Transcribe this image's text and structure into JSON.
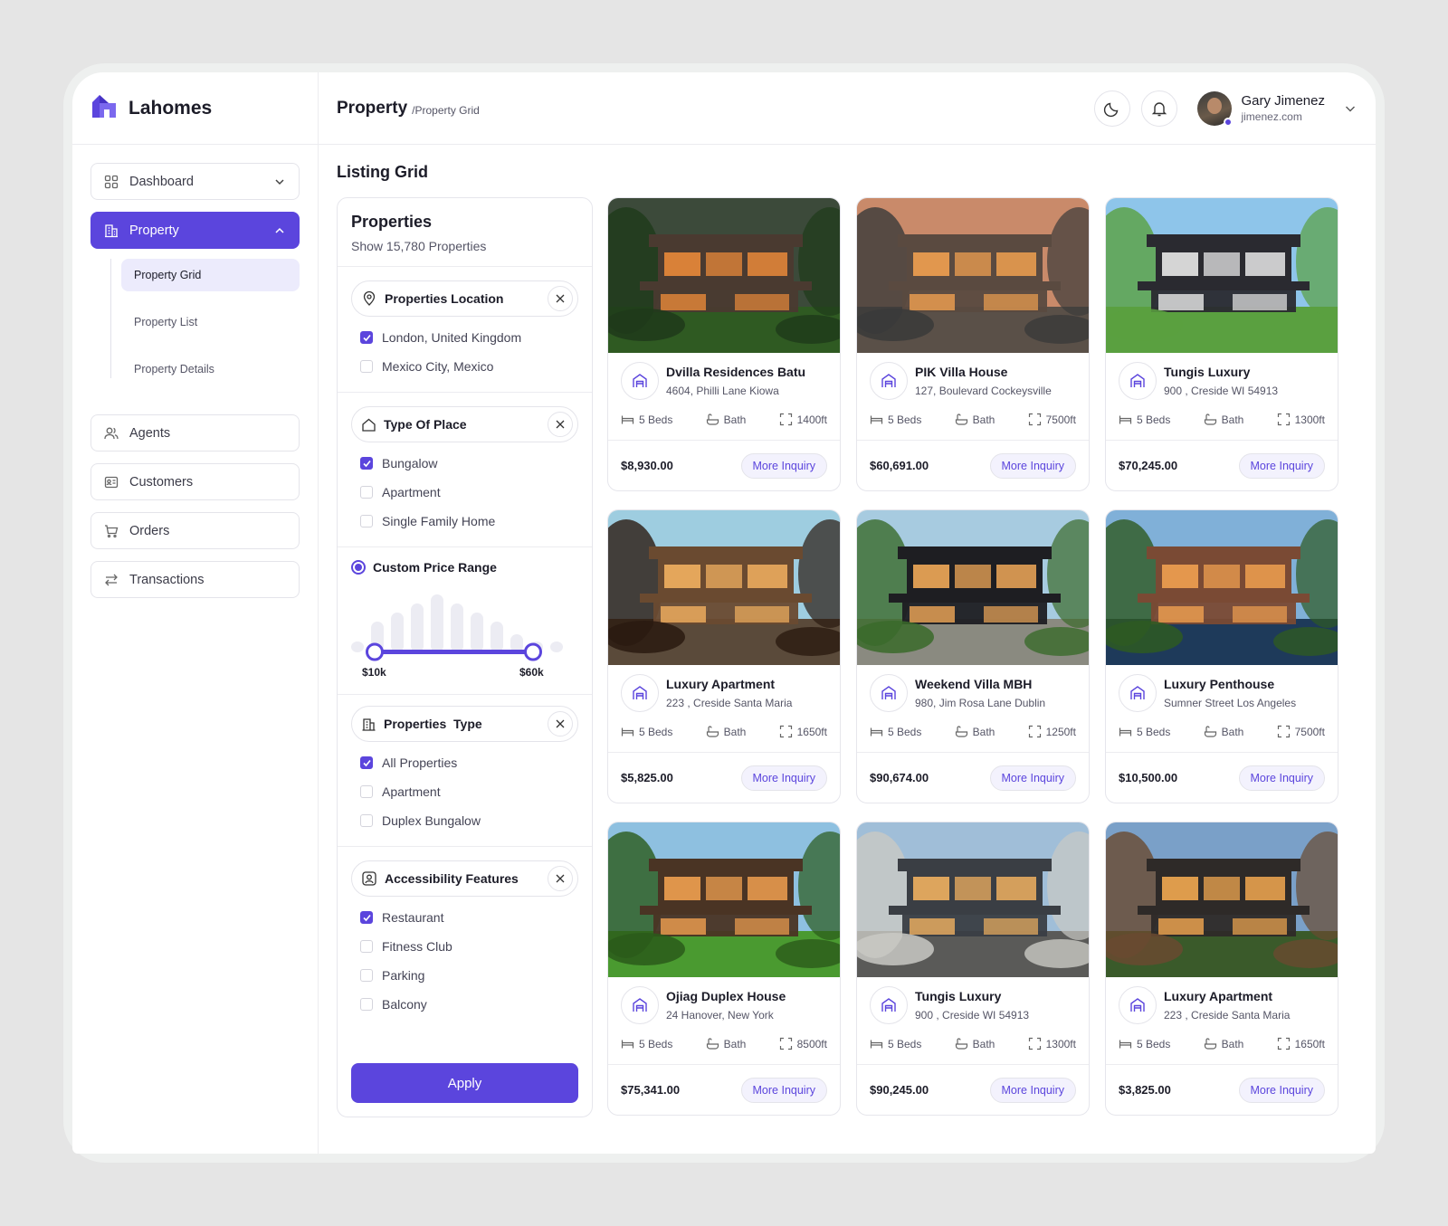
{
  "brand": {
    "name": "Lahomes"
  },
  "header": {
    "title": "Property",
    "breadcrumb": "/Property Grid"
  },
  "user": {
    "name": "Gary Jimenez",
    "email": "jimenez.com"
  },
  "sidebar": {
    "items": [
      {
        "label": "Dashboard"
      },
      {
        "label": "Property"
      },
      {
        "label": "Agents"
      },
      {
        "label": "Customers"
      },
      {
        "label": "Orders"
      },
      {
        "label": "Transactions"
      }
    ],
    "subitems": [
      {
        "label": "Property Grid"
      },
      {
        "label": "Property List"
      },
      {
        "label": "Property Details"
      }
    ]
  },
  "page": {
    "title": "Listing Grid"
  },
  "filter": {
    "title": "Properties",
    "count": "Show 15,780 Properties",
    "location": {
      "label": "Properties Location",
      "options": [
        {
          "label": "London, United Kingdom",
          "checked": true
        },
        {
          "label": "Mexico City, Mexico",
          "checked": false
        }
      ]
    },
    "place": {
      "label": "Type Of Place",
      "options": [
        {
          "label": "Bungalow",
          "checked": true
        },
        {
          "label": "Apartment",
          "checked": false
        },
        {
          "label": "Single Family Home",
          "checked": false
        }
      ]
    },
    "price": {
      "label": "Custom Price Range",
      "min_label": "$10k",
      "max_label": "$60k"
    },
    "ptype": {
      "label": "Properties  Type",
      "options": [
        {
          "label": "All Properties",
          "checked": true
        },
        {
          "label": "Apartment",
          "checked": false
        },
        {
          "label": "Duplex Bungalow",
          "checked": false
        }
      ]
    },
    "access": {
      "label": "Accessibility Features",
      "options": [
        {
          "label": "Restaurant",
          "checked": true
        },
        {
          "label": "Fitness Club",
          "checked": false
        },
        {
          "label": "Parking",
          "checked": false
        },
        {
          "label": "Balcony",
          "checked": false
        }
      ]
    },
    "apply": "Apply"
  },
  "listings": [
    {
      "name": "Dvilla Residences Batu",
      "address": "4604, Philli Lane Kiowa",
      "beds": "5 Beds",
      "bath": "Bath",
      "area": "1400ft",
      "price": "$8,930.00",
      "cta": "More Inquiry"
    },
    {
      "name": "PIK Villa House",
      "address": "127, Boulevard Cockeysville",
      "beds": "5 Beds",
      "bath": "Bath",
      "area": "7500ft",
      "price": "$60,691.00",
      "cta": "More Inquiry"
    },
    {
      "name": "Tungis Luxury",
      "address": "900 , Creside WI 54913",
      "beds": "5 Beds",
      "bath": "Bath",
      "area": "1300ft",
      "price": "$70,245.00",
      "cta": "More Inquiry"
    },
    {
      "name": "Luxury Apartment",
      "address": "223 , Creside Santa Maria",
      "beds": "5 Beds",
      "bath": "Bath",
      "area": "1650ft",
      "price": "$5,825.00",
      "cta": "More Inquiry"
    },
    {
      "name": "Weekend Villa MBH",
      "address": "980, Jim Rosa Lane Dublin",
      "beds": "5 Beds",
      "bath": "Bath",
      "area": "1250ft",
      "price": "$90,674.00",
      "cta": "More Inquiry"
    },
    {
      "name": "Luxury Penthouse",
      "address": "Sumner Street Los Angeles",
      "beds": "5 Beds",
      "bath": "Bath",
      "area": "7500ft",
      "price": "$10,500.00",
      "cta": "More Inquiry"
    },
    {
      "name": "Ojiag Duplex House",
      "address": "24 Hanover, New York",
      "beds": "5 Beds",
      "bath": "Bath",
      "area": "8500ft",
      "price": "$75,341.00",
      "cta": "More Inquiry"
    },
    {
      "name": "Tungis Luxury",
      "address": "900 , Creside WI 54913",
      "beds": "5 Beds",
      "bath": "Bath",
      "area": "1300ft",
      "price": "$90,245.00",
      "cta": "More Inquiry"
    },
    {
      "name": "Luxury Apartment",
      "address": "223 , Creside Santa Maria",
      "beds": "5 Beds",
      "bath": "Bath",
      "area": "1650ft",
      "price": "$3,825.00",
      "cta": "More Inquiry"
    }
  ],
  "colors": {
    "accent": "#5b45dd",
    "accent_light": "#ecebfc"
  }
}
